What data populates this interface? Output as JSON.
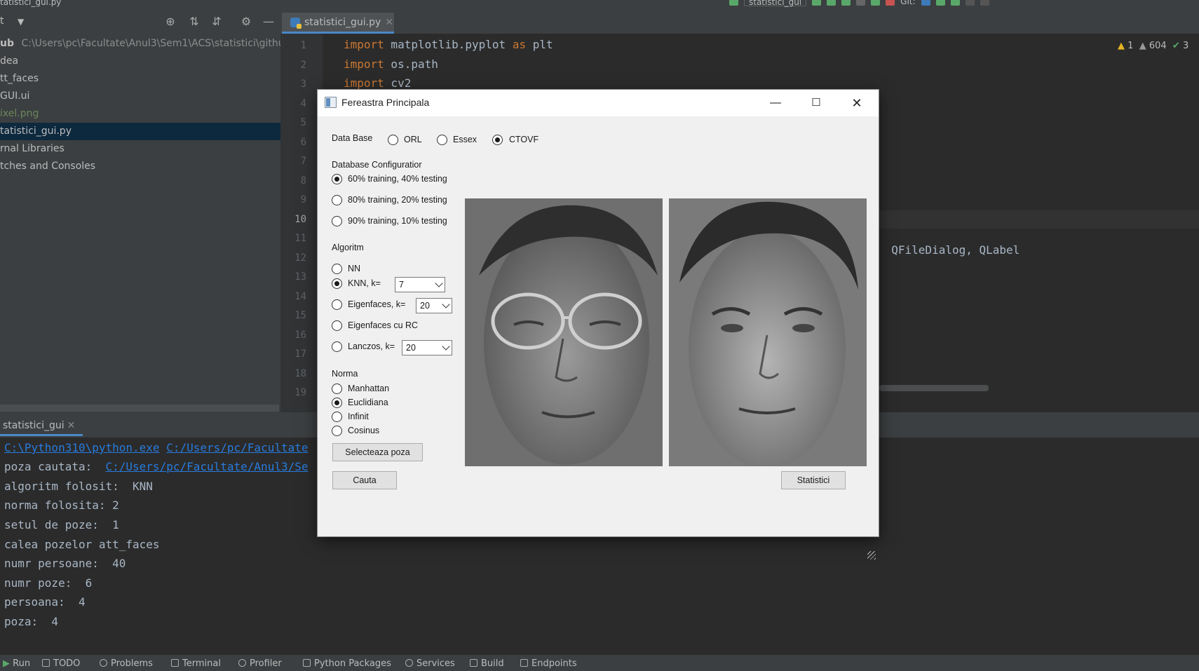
{
  "topbar": {
    "title": "tatistici_gui.py",
    "run_config": "statistici_gui",
    "git_label": "Git:"
  },
  "project_panel": {
    "header_label": "t",
    "items": [
      {
        "label": "ub",
        "path": "C:\\Users\\pc\\Facultate\\Anul3\\Sem1\\ACS\\statistici\\github"
      },
      {
        "label": "dea"
      },
      {
        "label": "tt_faces"
      },
      {
        "label": "GUI.ui"
      },
      {
        "label": "ixel.png"
      },
      {
        "label": "tatistici_gui.py"
      },
      {
        "label": "rnal Libraries"
      },
      {
        "label": "tches and Consoles"
      }
    ]
  },
  "editor": {
    "tab_label": "statistici_gui.py",
    "line_numbers": [
      "1",
      "2",
      "3",
      "4",
      "5",
      "6",
      "7",
      "8",
      "9",
      "10",
      "11",
      "12",
      "13",
      "14",
      "15",
      "16",
      "17",
      "18",
      "19"
    ],
    "lines": [
      {
        "kw": "import",
        "rest": " matplotlib.pyplot ",
        "kw2": "as",
        "rest2": " plt"
      },
      {
        "kw": "import",
        "rest": " os.path"
      },
      {
        "kw": "import",
        "rest": " cv2"
      }
    ],
    "code_fragment": "QFileDialog, QLabel",
    "inspections": {
      "warnings": "1",
      "weak_warnings": "604",
      "ok": "3"
    }
  },
  "run_panel": {
    "tab_label": "statistici_gui",
    "console": {
      "cmd_exe": "C:\\Python310\\python.exe",
      "cmd_script": "C:/Users/pc/Facultate",
      "poza_label": "poza cautata:",
      "poza_path": "C:/Users/pc/Facultate/Anul3/Se",
      "lines": [
        "algoritm folosit:  KNN",
        "norma folosita: 2",
        "setul de poze:  1",
        "calea pozelor att_faces",
        "numr persoane:  40",
        "numr poze:  6",
        "persoana:  4",
        "poza:  4"
      ]
    }
  },
  "bottom_bar": [
    "Run",
    "TODO",
    "Problems",
    "Terminal",
    "Profiler",
    "Python Packages",
    "Services",
    "Build",
    "Endpoints"
  ],
  "dialog": {
    "title": "Fereastra Principala",
    "data_base": {
      "label": "Data Base",
      "options": [
        "ORL",
        "Essex",
        "CTOVF"
      ],
      "selected": "CTOVF"
    },
    "db_config": {
      "label": "Database Configuratior",
      "options": [
        "60% training, 40% testing",
        "80% training, 20% testing",
        "90% training, 10% testing"
      ],
      "selected": "60% training, 40% testing"
    },
    "algoritm": {
      "label": "Algoritm",
      "nn": "NN",
      "knn": "KNN, k=",
      "knn_k": "7",
      "eigenfaces": "Eigenfaces, k=",
      "eigenfaces_k": "20",
      "eigenfaces_rc": "Eigenfaces cu RC",
      "lanczos": "Lanczos, k=",
      "lanczos_k": "20",
      "selected": "KNN, k="
    },
    "norma": {
      "label": "Norma",
      "options": [
        "Manhattan",
        "Euclidiana",
        "Infinit",
        "Cosinus"
      ],
      "selected": "Euclidiana"
    },
    "buttons": {
      "select_photo": "Selecteaza poza",
      "search": "Cauta",
      "statistics": "Statistici"
    }
  }
}
